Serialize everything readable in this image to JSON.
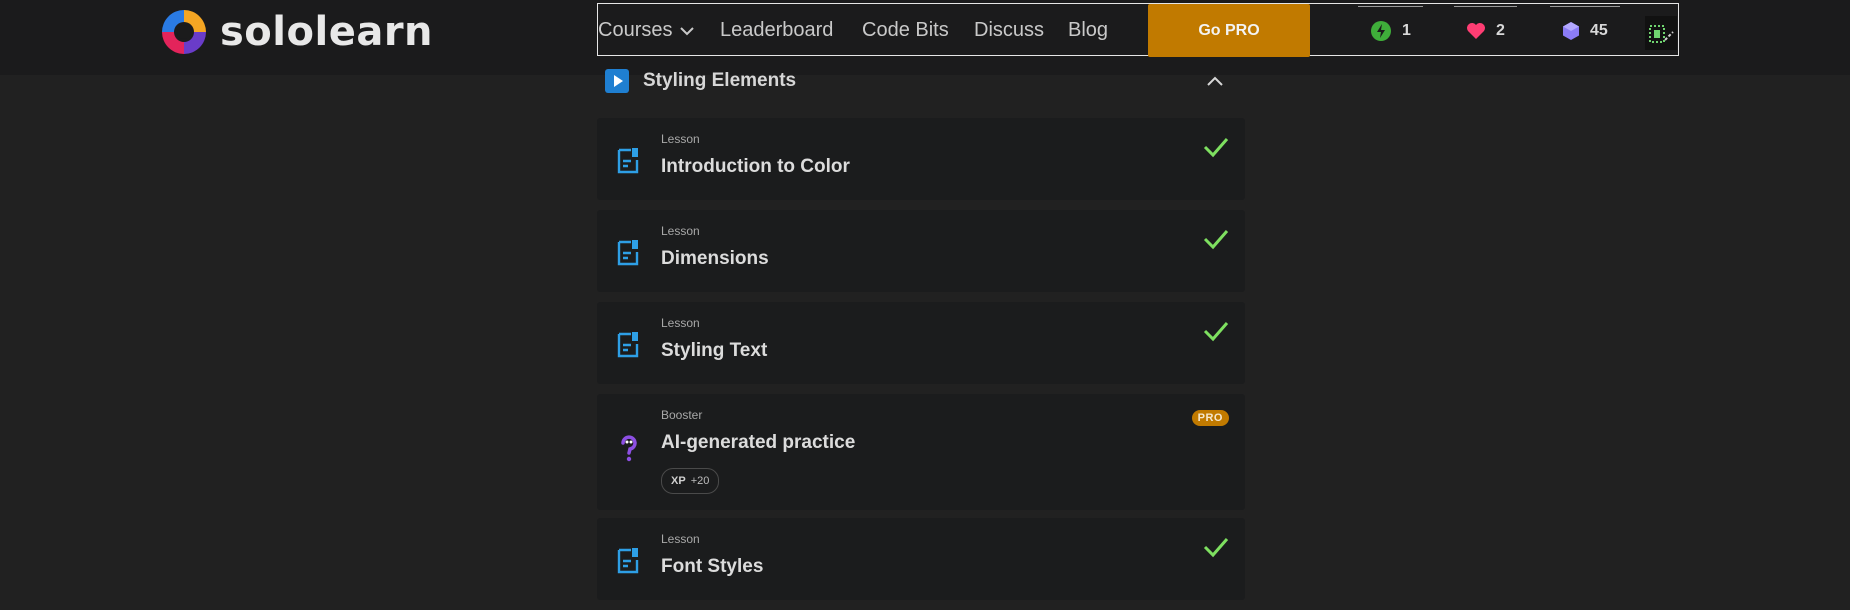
{
  "brand": {
    "name": "sololearn"
  },
  "nav": {
    "courses": "Courses",
    "leaderboard": "Leaderboard",
    "code_bits": "Code Bits",
    "discuss": "Discuss",
    "blog": "Blog",
    "go_pro": "Go PRO"
  },
  "stats": {
    "streak": {
      "icon": "bolt-icon",
      "value": "1",
      "color": "#3fae3a"
    },
    "hearts": {
      "icon": "heart-icon",
      "value": "2",
      "color": "#ff3d73"
    },
    "gems": {
      "icon": "gem-icon",
      "value": "45",
      "color": "#8b7cf6"
    }
  },
  "section": {
    "title": "Styling Elements",
    "icon": "play-icon"
  },
  "items": [
    {
      "type": "Lesson",
      "title": "Introduction to Color",
      "status": "completed"
    },
    {
      "type": "Lesson",
      "title": "Dimensions",
      "status": "completed"
    },
    {
      "type": "Lesson",
      "title": "Styling Text",
      "status": "completed"
    },
    {
      "type": "Booster",
      "title": "AI-generated practice",
      "badge": "PRO",
      "xp_label": "XP",
      "xp_value": "+20"
    },
    {
      "type": "Lesson",
      "title": "Font Styles",
      "status": "completed"
    }
  ],
  "colors": {
    "accent": "#c17a00",
    "check": "#7ee060",
    "lesson_icon": "#2e9fe6",
    "background": "#212121"
  }
}
